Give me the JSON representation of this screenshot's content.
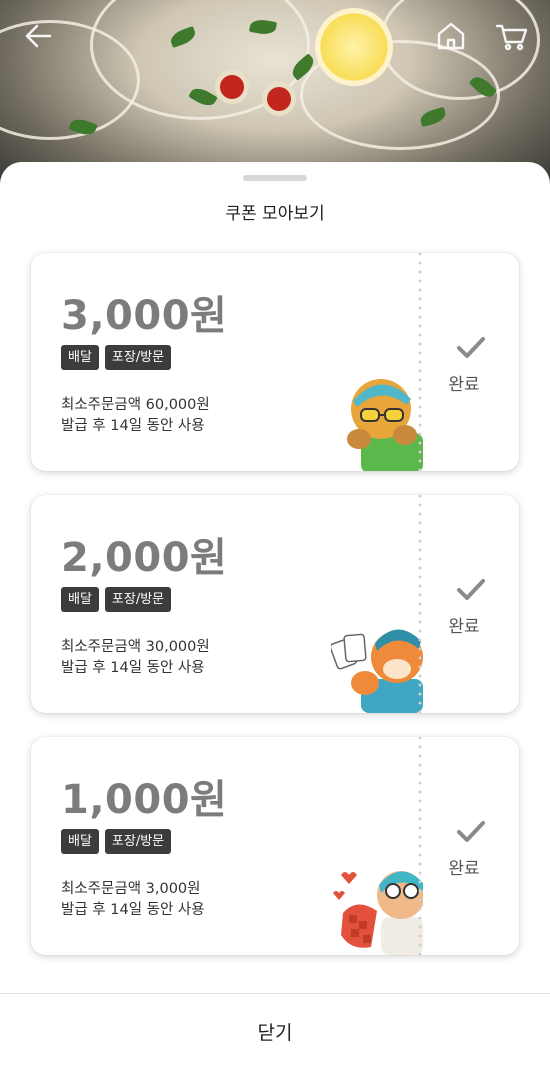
{
  "header": {
    "icons": [
      "back-arrow-icon",
      "home-icon",
      "cart-icon"
    ]
  },
  "sheet": {
    "title": "쿠폰 모아보기",
    "close_label": "닫기"
  },
  "coupons": [
    {
      "amount": "3,000원",
      "tags": [
        "배달",
        "포장/방문"
      ],
      "min_order": "최소주문금액 60,000원",
      "validity": "발급 후 14일 동안 사용",
      "status": "완료"
    },
    {
      "amount": "2,000원",
      "tags": [
        "배달",
        "포장/방문"
      ],
      "min_order": "최소주문금액 30,000원",
      "validity": "발급 후 14일 동안 사용",
      "status": "완료"
    },
    {
      "amount": "1,000원",
      "tags": [
        "배달",
        "포장/방문"
      ],
      "min_order": "최소주문금액 3,000원",
      "validity": "발급 후 14일 동안 사용",
      "status": "완료"
    }
  ],
  "colors": {
    "tag_bg": "#3c3c3c",
    "amount_text": "#7c7c7c",
    "sheet_bg": "#ffffff"
  }
}
